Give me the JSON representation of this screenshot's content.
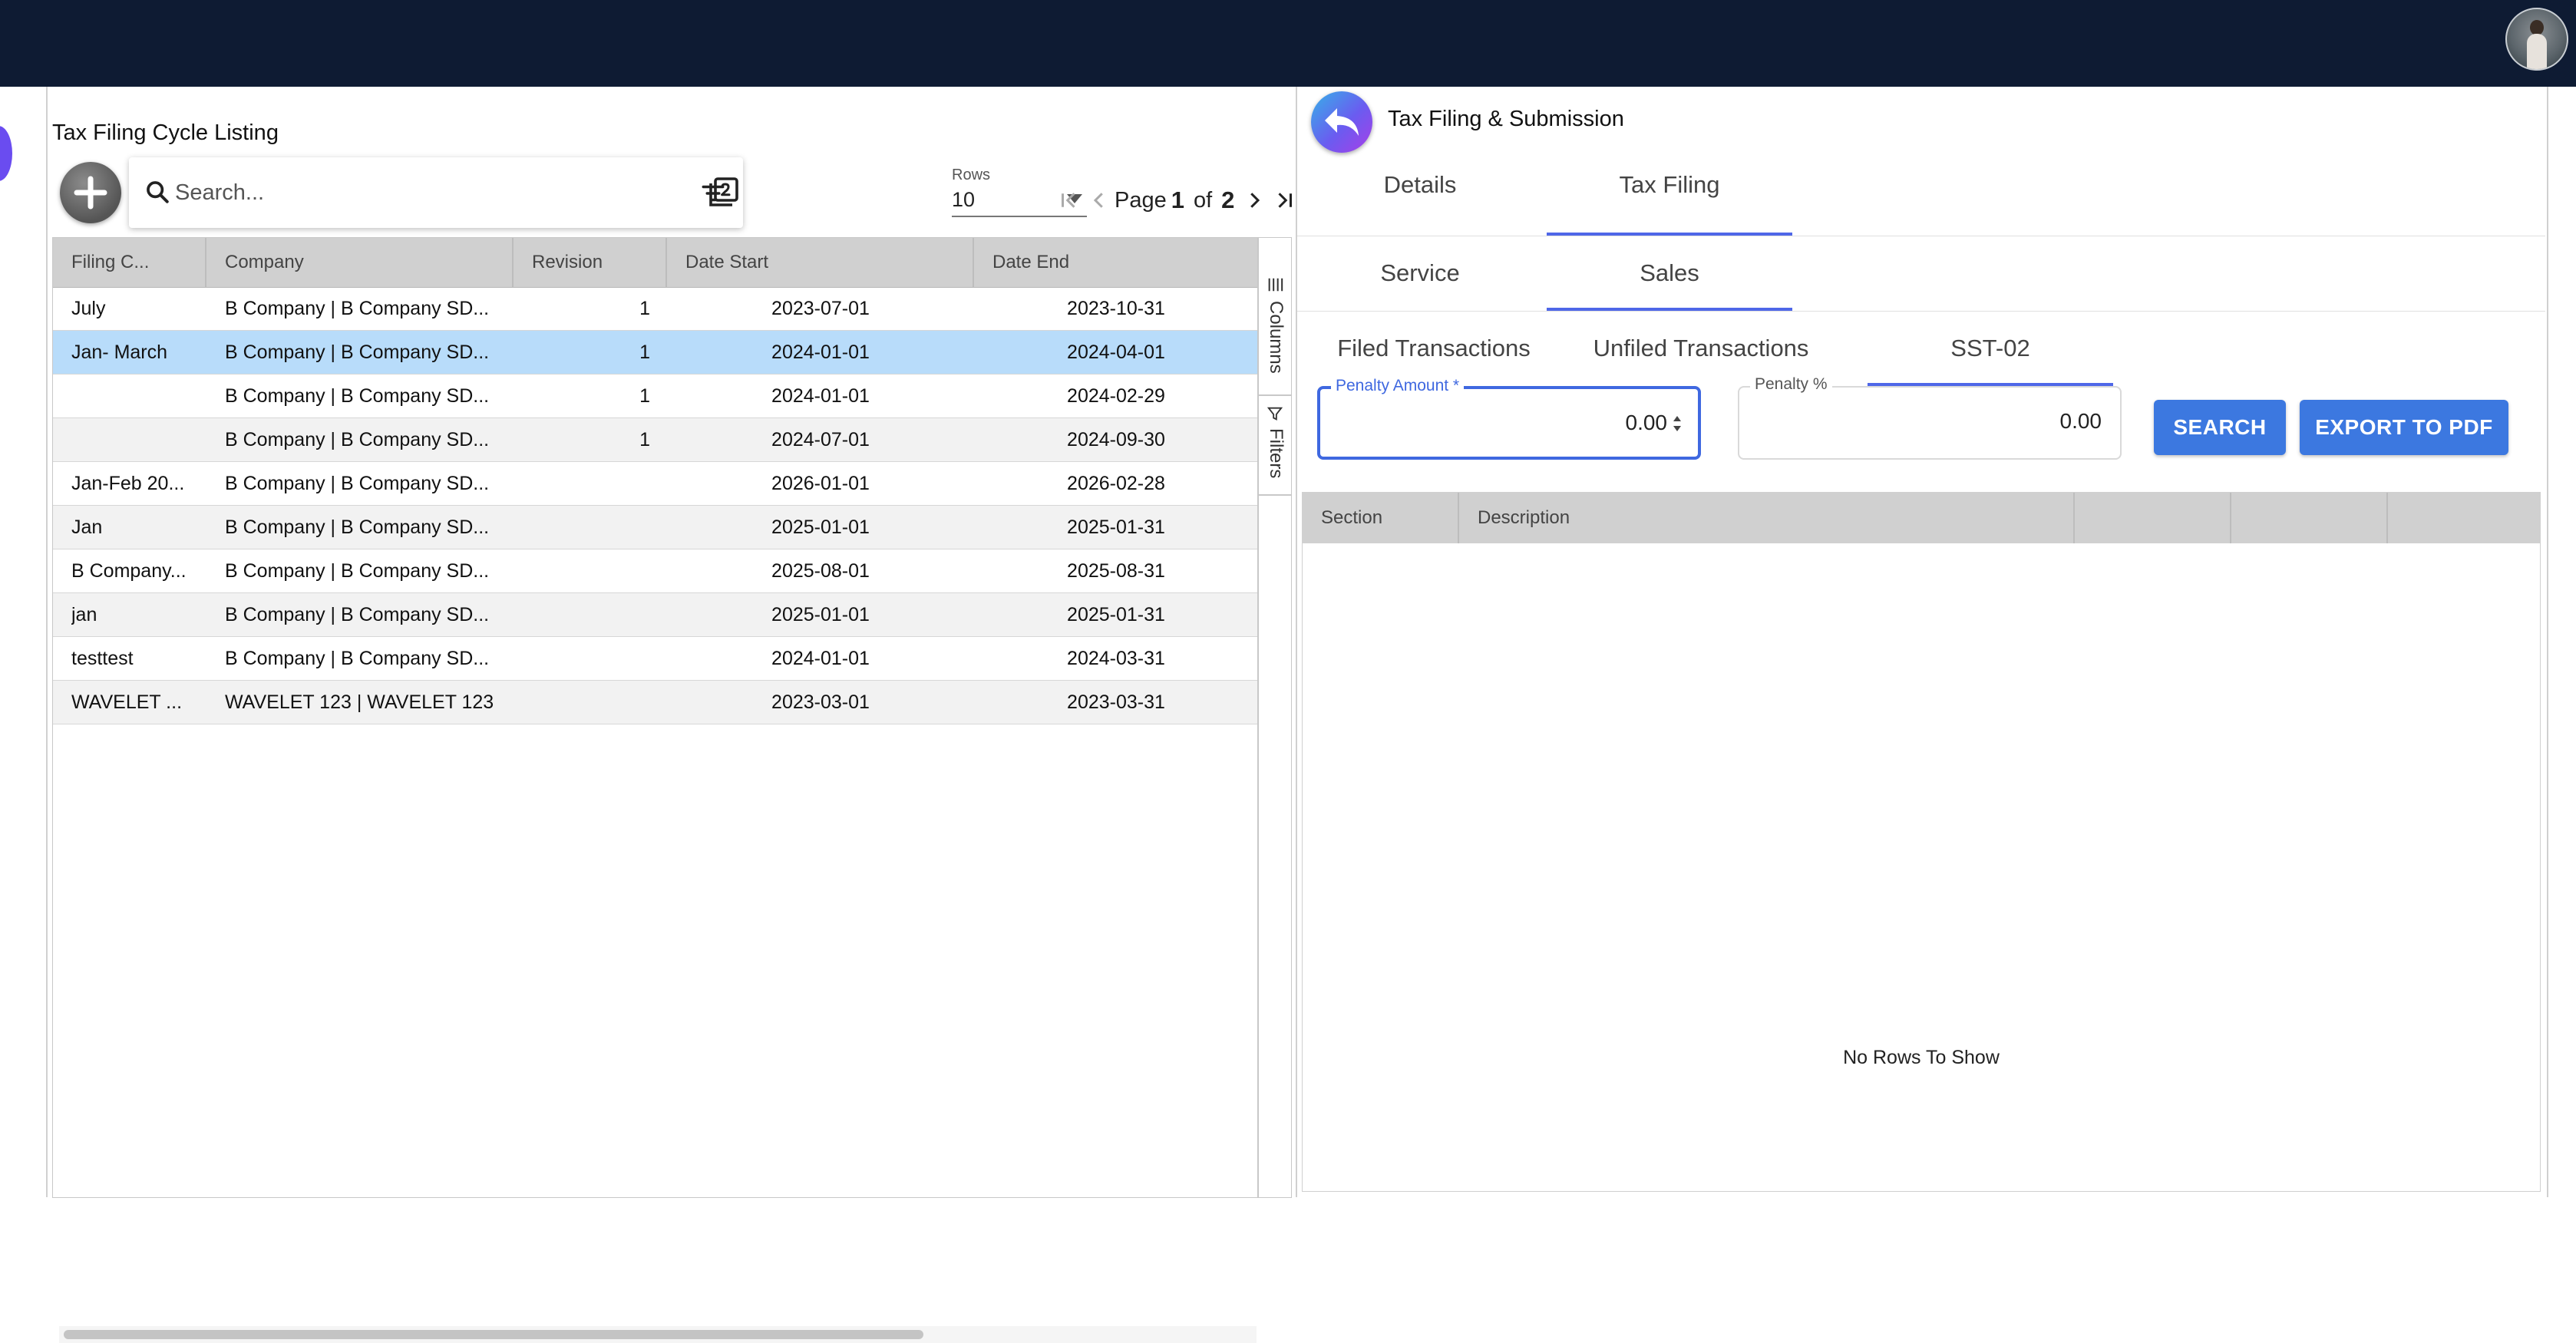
{
  "colors": {
    "topbar": "#0e1b33",
    "accent": "#3c78e0",
    "tab_underline": "#4f67e8",
    "selected_row": "#b8dcfa"
  },
  "topbar": {
    "avatar": "user-avatar-photo"
  },
  "left": {
    "title": "Tax Filing Cycle Listing",
    "search": {
      "placeholder": "Search..."
    },
    "rows": {
      "label": "Rows",
      "value": "10"
    },
    "pager": {
      "page_label": "Page",
      "page": "1",
      "of_label": "of",
      "total": "2"
    },
    "grid": {
      "columns": [
        "Filing C...",
        "Company",
        "Revision",
        "Date Start",
        "Date End"
      ],
      "rows": [
        {
          "filing": "July",
          "company": "B Company | B Company SD...",
          "revision": "1",
          "start": "2023-07-01",
          "end": "2023-10-31"
        },
        {
          "filing": "Jan- March",
          "company": "B Company | B Company SD...",
          "revision": "1",
          "start": "2024-01-01",
          "end": "2024-04-01"
        },
        {
          "filing": "",
          "company": "B Company | B Company SD...",
          "revision": "1",
          "start": "2024-01-01",
          "end": "2024-02-29"
        },
        {
          "filing": "",
          "company": "B Company | B Company SD...",
          "revision": "1",
          "start": "2024-07-01",
          "end": "2024-09-30"
        },
        {
          "filing": "Jan-Feb 20...",
          "company": "B Company | B Company SD...",
          "revision": "",
          "start": "2026-01-01",
          "end": "2026-02-28"
        },
        {
          "filing": "Jan",
          "company": "B Company | B Company SD...",
          "revision": "",
          "start": "2025-01-01",
          "end": "2025-01-31"
        },
        {
          "filing": "B Company...",
          "company": "B Company | B Company SD...",
          "revision": "",
          "start": "2025-08-01",
          "end": "2025-08-31"
        },
        {
          "filing": "jan",
          "company": "B Company | B Company SD...",
          "revision": "",
          "start": "2025-01-01",
          "end": "2025-01-31"
        },
        {
          "filing": "testtest",
          "company": "B Company | B Company SD...",
          "revision": "",
          "start": "2024-01-01",
          "end": "2024-03-31"
        },
        {
          "filing": "WAVELET ...",
          "company": "WAVELET 123 | WAVELET 123",
          "revision": "",
          "start": "2023-03-01",
          "end": "2023-03-31"
        }
      ]
    },
    "side_tools": {
      "columns": "Columns",
      "filters": "Filters"
    }
  },
  "right": {
    "title": "Tax Filing & Submission",
    "tabs1": [
      {
        "label": "Details"
      },
      {
        "label": "Tax Filing"
      }
    ],
    "tabs2": [
      {
        "label": "Service"
      },
      {
        "label": "Sales"
      }
    ],
    "tabs3": [
      {
        "label": "Filed Transactions"
      },
      {
        "label": "Unfiled Transactions"
      },
      {
        "label": "SST-02"
      }
    ],
    "penalty_amount": {
      "label": "Penalty Amount *",
      "value": "0.00"
    },
    "penalty_pct": {
      "label": "Penalty %",
      "value": "0.00"
    },
    "search_button": "SEARCH",
    "export_button": "EXPORT TO PDF",
    "grid": {
      "columns": [
        "Section",
        "Description",
        "",
        "",
        ""
      ],
      "empty": "No Rows To Show"
    }
  }
}
